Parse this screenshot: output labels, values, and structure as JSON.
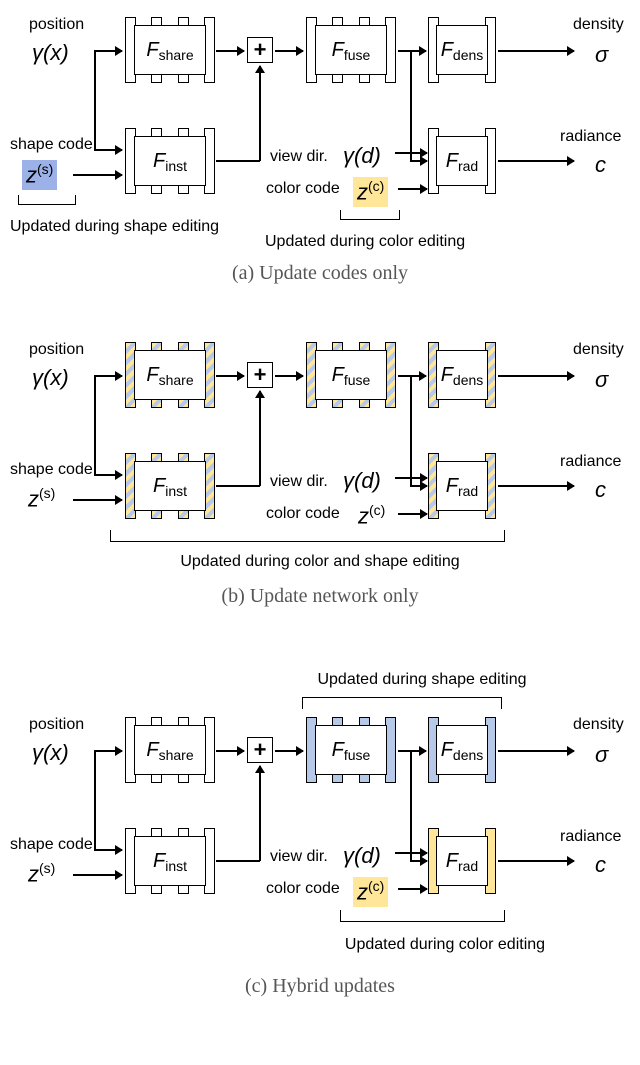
{
  "labels": {
    "position": "position",
    "shape_code": "shape code",
    "view_dir": "view dir.",
    "color_code": "color code",
    "density": "density",
    "radiance": "radiance"
  },
  "sym": {
    "gamma_x": "γ(x)",
    "gamma_d": "γ(d)",
    "zs": "z",
    "zs_sup": "(s)",
    "zc": "z",
    "zc_sup": "(c)",
    "sigma": "σ",
    "c": "c",
    "plus": "+"
  },
  "mods": {
    "share": "F",
    "share_sub": "share",
    "inst": "F",
    "inst_sub": "inst",
    "fuse": "F",
    "fuse_sub": "fuse",
    "dens": "F",
    "dens_sub": "dens",
    "rad": "F",
    "rad_sub": "rad"
  },
  "notes": {
    "a_shape": "Updated during shape editing",
    "a_color": "Updated during color editing",
    "b": "Updated during color and shape editing",
    "c_shape": "Updated during shape editing",
    "c_color": "Updated during color editing"
  },
  "captions": {
    "a": "(a) Update codes only",
    "b": "(b) Update network only",
    "c": "(c) Hybrid updates"
  }
}
